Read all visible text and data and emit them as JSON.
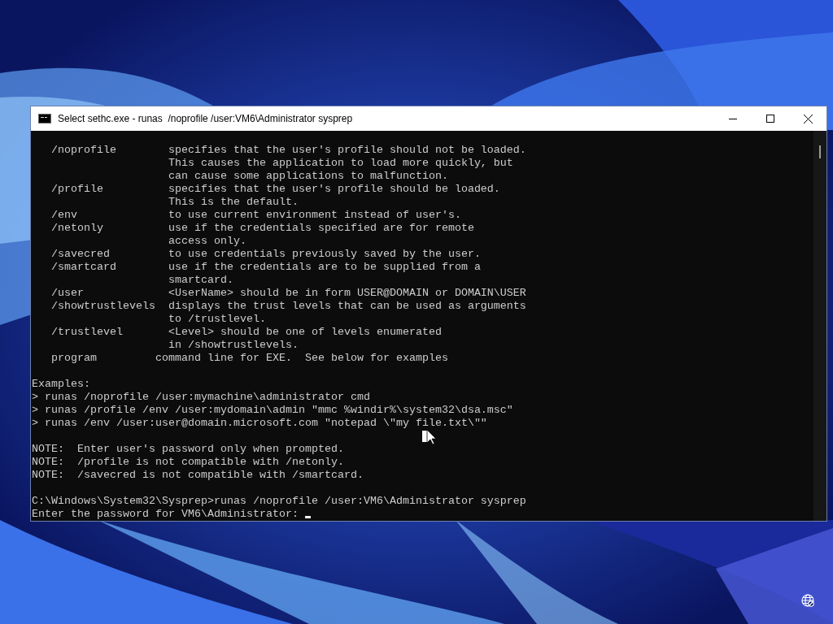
{
  "window": {
    "title": "Select sethc.exe - runas  /noprofile /user:VM6\\Administrator sysprep"
  },
  "console": {
    "blocks": [
      [
        "   /noprofile        specifies that the user's profile should not be loaded.",
        "                     This causes the application to load more quickly, but",
        "                     can cause some applications to malfunction.",
        "   /profile          specifies that the user's profile should be loaded.",
        "                     This is the default.",
        "   /env              to use current environment instead of user's.",
        "   /netonly          use if the credentials specified are for remote",
        "                     access only.",
        "   /savecred         to use credentials previously saved by the user.",
        "   /smartcard        use if the credentials are to be supplied from a",
        "                     smartcard.",
        "   /user             <UserName> should be in form USER@DOMAIN or DOMAIN\\USER",
        "   /showtrustlevels  displays the trust levels that can be used as arguments",
        "                     to /trustlevel.",
        "   /trustlevel       <Level> should be one of levels enumerated",
        "                     in /showtrustlevels.",
        "   program         command line for EXE.  See below for examples"
      ],
      [
        "Examples:",
        "> runas /noprofile /user:mymachine\\administrator cmd",
        "> runas /profile /env /user:mydomain\\admin \"mmc %windir%\\system32\\dsa.msc\"",
        "> runas /env /user:user@domain.microsoft.com \"notepad \\\"my file.txt\\\"\""
      ],
      [
        "NOTE:  Enter user's password only when prompted.",
        "NOTE:  /profile is not compatible with /netonly.",
        "NOTE:  /savecred is not compatible with /smartcard."
      ],
      [
        "C:\\Windows\\System32\\Sysprep>runas /noprofile /user:VM6\\Administrator sysprep"
      ]
    ],
    "prompt": "Enter the password for VM6\\Administrator:"
  }
}
